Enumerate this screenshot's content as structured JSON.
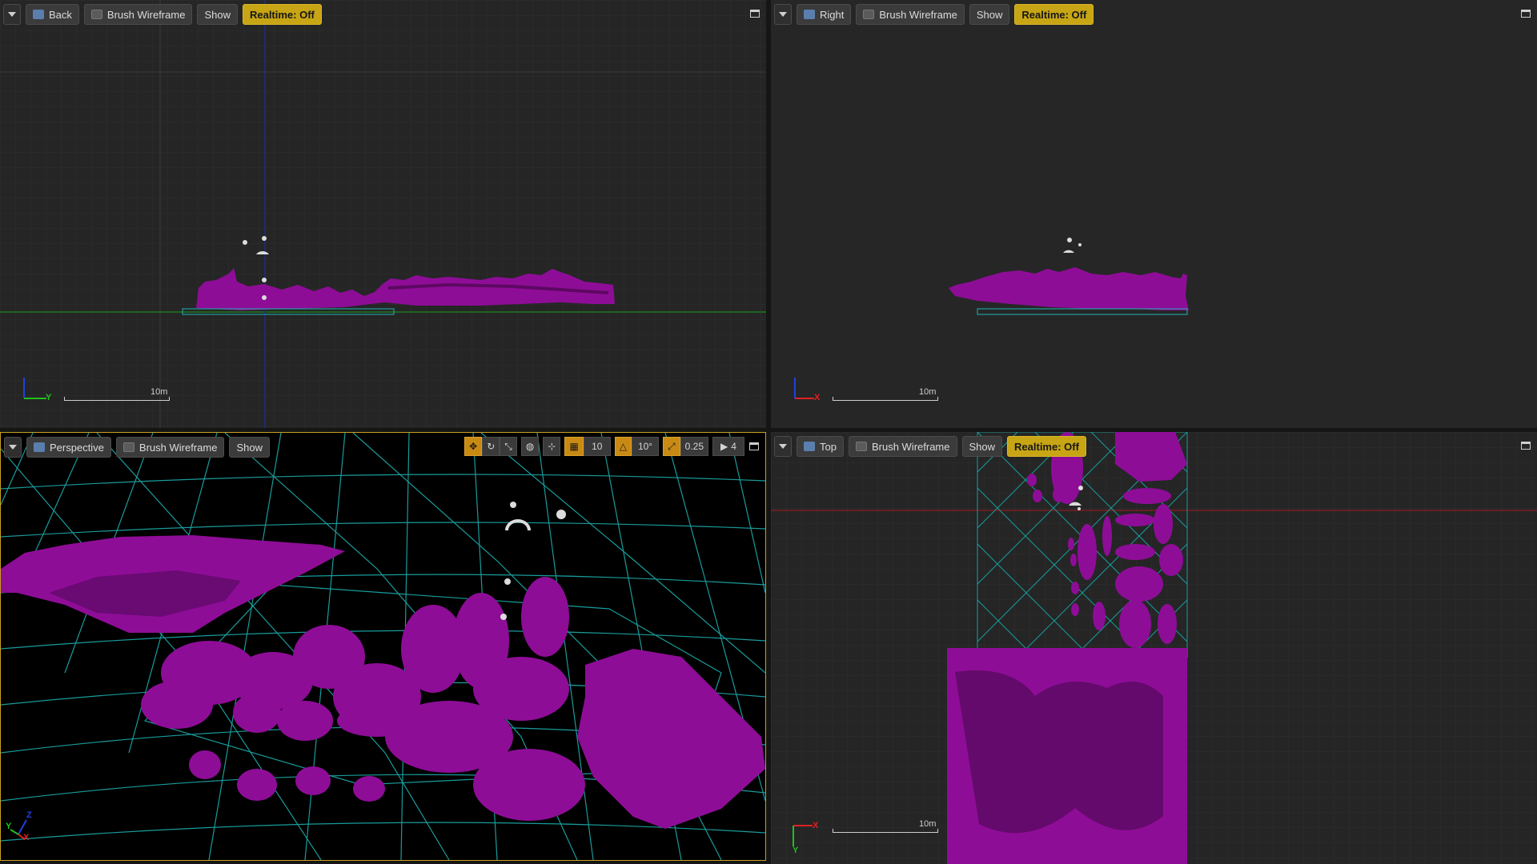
{
  "viewports": {
    "back": {
      "camera_label": "Back",
      "view_mode_label": "Brush Wireframe",
      "show_label": "Show",
      "realtime_label": "Realtime: Off",
      "scale_label": "10m",
      "axes": [
        "Y"
      ]
    },
    "right": {
      "camera_label": "Right",
      "view_mode_label": "Brush Wireframe",
      "show_label": "Show",
      "realtime_label": "Realtime: Off",
      "scale_label": "10m",
      "axes": [
        "X"
      ]
    },
    "perspective": {
      "camera_label": "Perspective",
      "view_mode_label": "Brush Wireframe",
      "show_label": "Show",
      "grid_snap_value": "10",
      "rotation_snap_value": "10°",
      "scale_snap_value": "0.25",
      "camera_speed_value": "4",
      "axes": [
        "X",
        "Y",
        "Z"
      ]
    },
    "top": {
      "camera_label": "Top",
      "view_mode_label": "Brush Wireframe",
      "show_label": "Show",
      "realtime_label": "Realtime: Off",
      "scale_label": "10m",
      "axes": [
        "X",
        "Y"
      ]
    }
  },
  "colors": {
    "panel_background": "#252525",
    "perspective_background": "#000000",
    "mesh_magenta": "#8e0d97",
    "wireframe_cyan": "#1fb5b5",
    "realtime_badge": "#c7a514",
    "active_border": "#c9a020",
    "axis_x": "#e02020",
    "axis_y": "#20c020",
    "axis_z": "#2040e0"
  },
  "icons": [
    "chevron-down-icon",
    "camera-icon",
    "wireframe-icon",
    "maximize-icon",
    "translate-icon",
    "rotate-icon",
    "scale-icon",
    "world-icon",
    "surface-snap-icon",
    "grid-snap-icon",
    "rotation-snap-icon",
    "scale-snap-icon",
    "camera-speed-icon"
  ]
}
